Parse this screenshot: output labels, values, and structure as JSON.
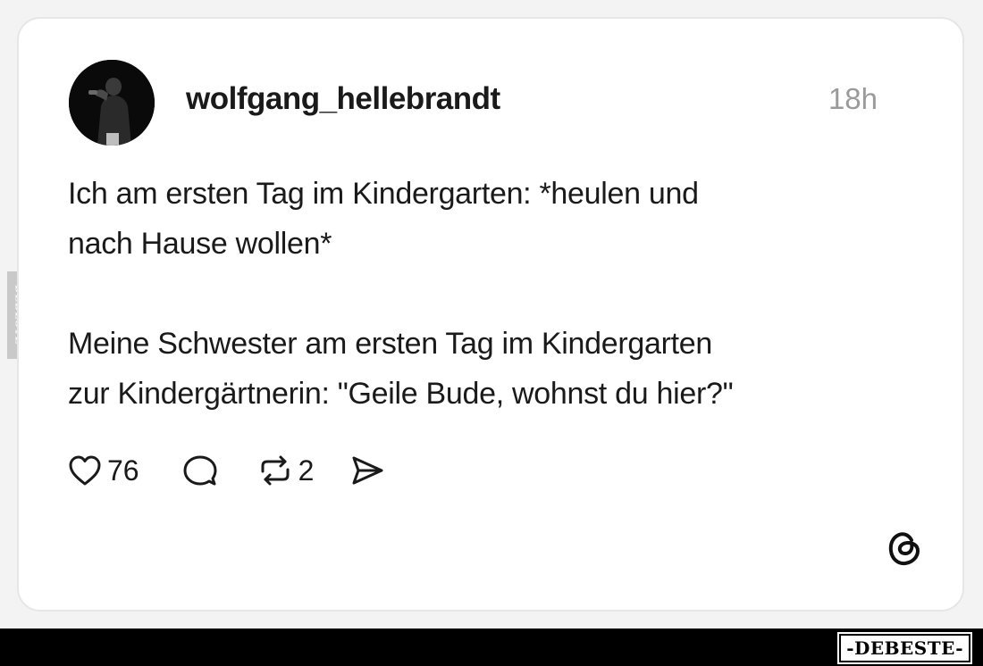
{
  "post": {
    "username": "wolfgang_hellebrandt",
    "timestamp": "18h",
    "text_line1": "Ich am ersten Tag im Kindergarten: *heulen und",
    "text_line2": "nach Hause wollen*",
    "text_line3": "Meine Schwester am ersten Tag im Kindergarten",
    "text_line4": "zur Kindergärtnerin: \"Geile Bude, wohnst du hier?\""
  },
  "actions": {
    "like_icon": "heart-icon",
    "like_count": "76",
    "comment_icon": "speech-bubble-icon",
    "repost_icon": "repost-arrows-icon",
    "repost_count": "2",
    "share_icon": "paper-plane-icon"
  },
  "branding": {
    "platform_logo": "threads-logo-icon",
    "side_watermark": "DEBESTE",
    "bottom_watermark": "-DEBESTE-"
  },
  "colors": {
    "card_background": "#ffffff",
    "page_background": "#f3f3f3",
    "text": "#1a1a1a",
    "timestamp": "#9a9a9a",
    "bottom_bar": "#000000"
  }
}
